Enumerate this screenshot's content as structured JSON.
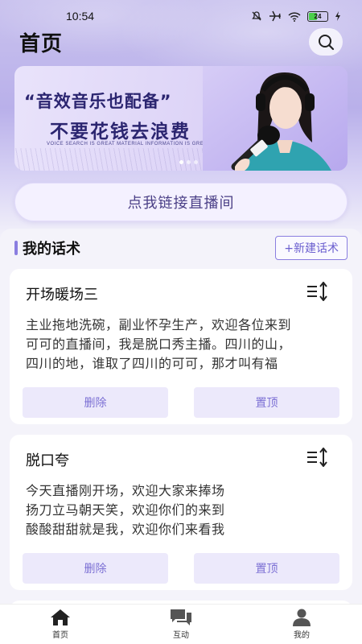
{
  "status_bar": {
    "time": "10:54",
    "battery": "24"
  },
  "header": {
    "title": "首页"
  },
  "banner": {
    "line1": "“音效音乐也配备”",
    "line2": "不要花钱去浪费",
    "subtitle": "VOICE SEARCH IS GREAT MATERIAL INFORMATION IS GREAT"
  },
  "connect_button": "点我链接直播间",
  "section": {
    "title": "我的话术",
    "new_button": "+新建话术"
  },
  "cards": [
    {
      "title": "开场暖场三",
      "lines": [
        "主业拖地洗碗，副业怀孕生产，欢迎各位来到",
        "可可的直播间，我是脱口秀主播。四川的山，",
        "四川的地，谁取了四川的可可，那才叫有福"
      ],
      "delete_label": "删除",
      "pin_label": "置顶"
    },
    {
      "title": "脱口夸",
      "lines": [
        "今天直播刚开场，欢迎大家来捧场",
        "扬刀立马朝天笑，欢迎你们的来到",
        "酸酸甜甜就是我，欢迎你们来看我"
      ],
      "delete_label": "删除",
      "pin_label": "置顶"
    }
  ],
  "tabbar": [
    {
      "label": "首页",
      "icon": "home-icon",
      "active": true
    },
    {
      "label": "互动",
      "icon": "chat-icon",
      "active": false
    },
    {
      "label": "我的",
      "icon": "user-icon",
      "active": false
    }
  ],
  "colors": {
    "accent": "#8a7ee0",
    "button_bg": "#ece9fb",
    "button_text": "#7c70d4"
  }
}
